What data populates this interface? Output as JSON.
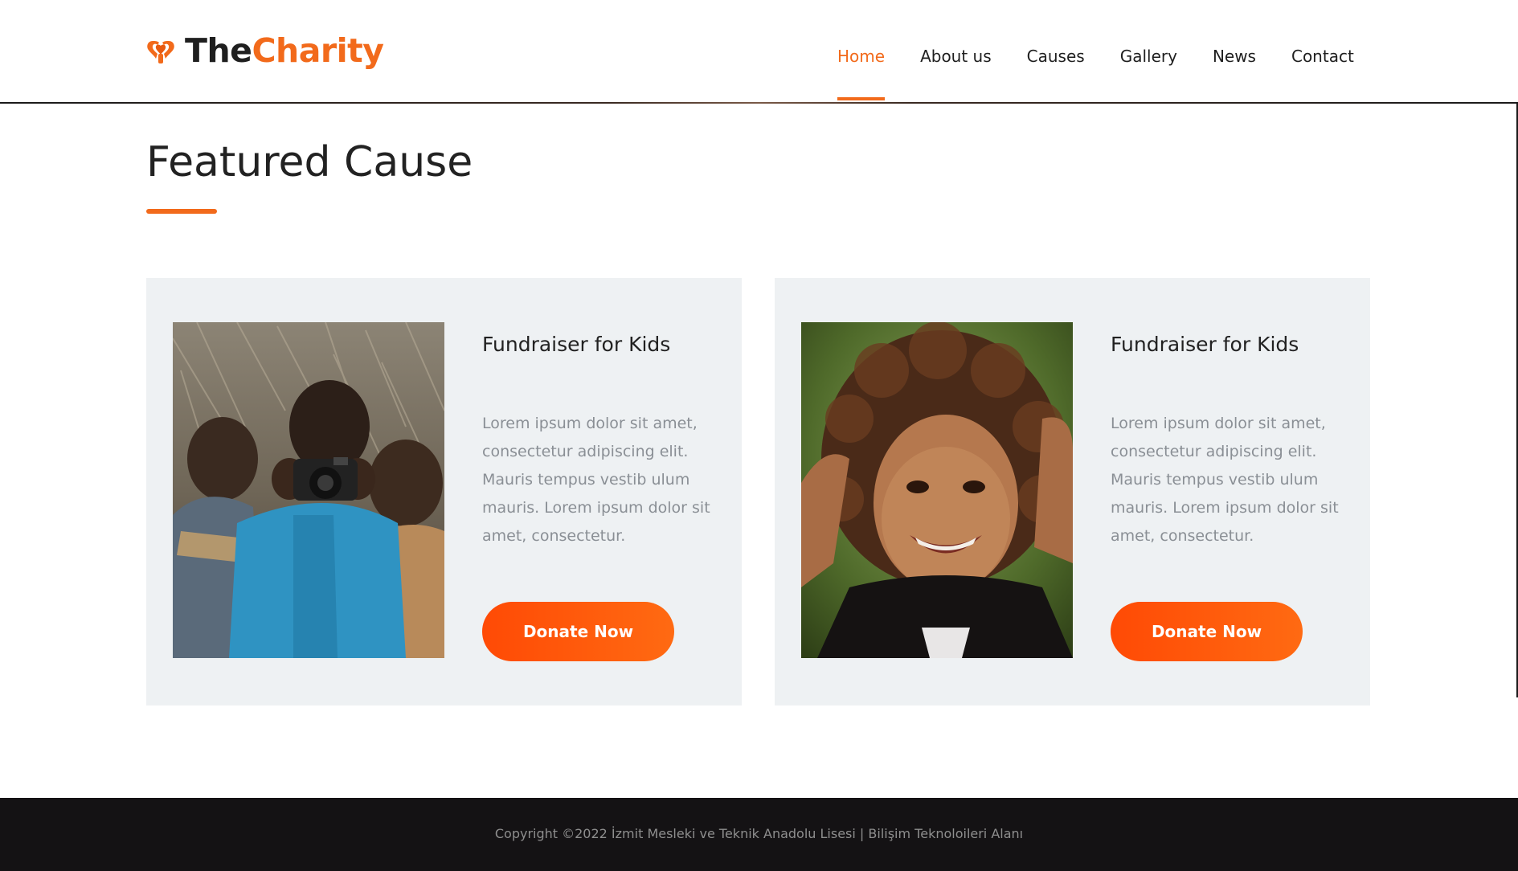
{
  "brand": {
    "name_part1": "The",
    "name_part2": "Charity",
    "logo_icon": "heart-hands-icon",
    "accent_color": "#f26a1b",
    "dark_color": "#1f1f1f"
  },
  "nav": {
    "items": [
      {
        "label": "Home",
        "active": true
      },
      {
        "label": "About us",
        "active": false
      },
      {
        "label": "Causes",
        "active": false
      },
      {
        "label": "Gallery",
        "active": false
      },
      {
        "label": "News",
        "active": false
      },
      {
        "label": "Contact",
        "active": false
      }
    ]
  },
  "section": {
    "title": "Featured Cause"
  },
  "causes": [
    {
      "title": "Fundraiser for Kids",
      "text": "Lorem ipsum dolor sit amet, consectetur adipiscing elit. Mauris tempus vestib ulum mauris. Lorem ipsum dolor sit amet, consectetur.",
      "button_label": "Donate Now"
    },
    {
      "title": "Fundraiser for Kids",
      "text": "Lorem ipsum dolor sit amet, consectetur adipiscing elit. Mauris tempus vestib ulum mauris. Lorem ipsum dolor sit amet, consectetur.",
      "button_label": "Donate Now"
    }
  ],
  "footer": {
    "copyright": "Copyright ©2022 İzmit Mesleki ve Teknik Anadolu Lisesi | Bilişim Teknoloileri Alanı",
    "background_color": "#141214"
  },
  "button_gradient": [
    "#ff4a05",
    "#ff6a12"
  ]
}
